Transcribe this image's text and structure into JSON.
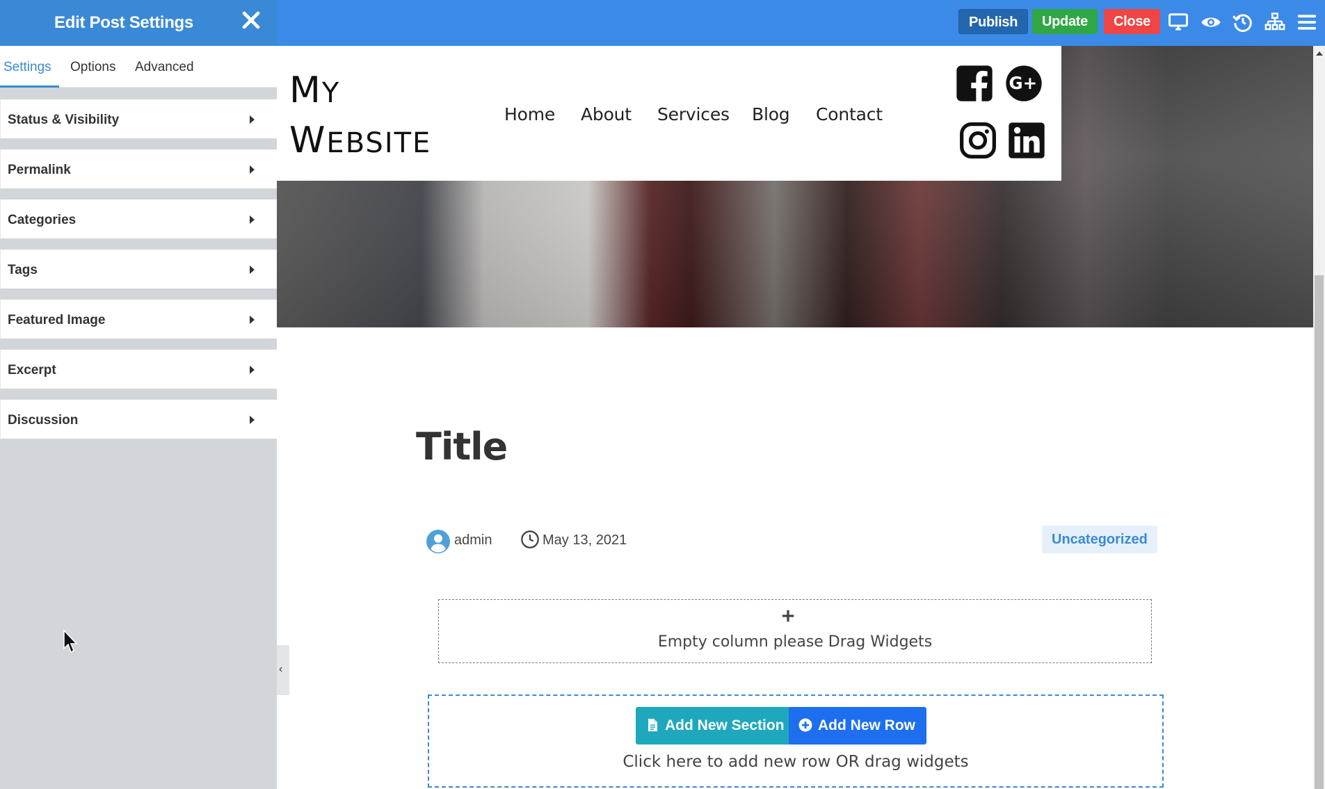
{
  "sidebar": {
    "title": "Edit Post Settings",
    "tabs": [
      {
        "label": "Settings",
        "active": true
      },
      {
        "label": "Options"
      },
      {
        "label": "Advanced"
      }
    ],
    "panels": [
      {
        "label": "Status & Visibility"
      },
      {
        "label": "Permalink"
      },
      {
        "label": "Categories"
      },
      {
        "label": "Tags"
      },
      {
        "label": "Featured Image"
      },
      {
        "label": "Excerpt"
      },
      {
        "label": "Discussion"
      }
    ]
  },
  "toolbar": {
    "publish_label": "Publish",
    "update_label": "Update",
    "close_label": "Close",
    "icons": [
      "desktop-icon",
      "eye-icon",
      "history-icon",
      "sitemap-icon",
      "menu-icon"
    ]
  },
  "site": {
    "logo_line1_cap": "M",
    "logo_line1_rest": "Y",
    "logo_line2_cap": "W",
    "logo_line2_rest": "EBSITE",
    "nav": [
      "Home",
      "About",
      "Services",
      "Blog",
      "Contact"
    ],
    "social": [
      "facebook-icon",
      "google-plus-icon",
      "instagram-icon",
      "linkedin-icon"
    ]
  },
  "post": {
    "title": "Title",
    "author": "admin",
    "date": "May 13, 2021",
    "category": "Uncategorized"
  },
  "builder": {
    "empty_column_text": "Empty column please Drag Widgets",
    "add_section_label": "Add New Section",
    "add_row_label": "Add New Row",
    "add_zone_text": "Click here to add new row OR drag widgets"
  },
  "colors": {
    "topbar": "#3c8ae8",
    "publish": "#2466ae",
    "update": "#2fa745",
    "close": "#ef4545",
    "add_section": "#1fa8bd",
    "add_row": "#1e6ef0"
  }
}
